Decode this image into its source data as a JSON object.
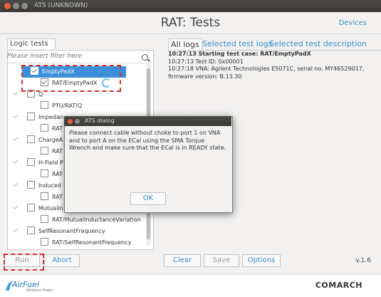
{
  "window": {
    "title": "ATS (UNKNOWN)"
  },
  "header": {
    "title": "RAT: Tests",
    "devices_link": "Devices"
  },
  "left": {
    "tab": "Logic tests",
    "filter_placeholder": "Please insert filter here",
    "tree": [
      {
        "label": "EmptyPadX",
        "level": 0,
        "selected": true,
        "checked": true
      },
      {
        "label": "RAT/EmptyPadX",
        "level": 1,
        "checked": true,
        "running": true
      },
      {
        "label": "Q",
        "level": 0
      },
      {
        "label": "PTU/RAT/Q",
        "level": 1
      },
      {
        "label": "Impedan",
        "level": 0
      },
      {
        "label": "RAT",
        "level": 1
      },
      {
        "label": "ChargeA",
        "level": 0
      },
      {
        "label": "RAT",
        "level": 1
      },
      {
        "label": "H-Field P",
        "level": 0
      },
      {
        "label": "RAT",
        "level": 1
      },
      {
        "label": "Induced",
        "level": 0
      },
      {
        "label": "RAT",
        "level": 1
      },
      {
        "label": "Mutualin",
        "level": 0
      },
      {
        "label": "RAT/MutualInductanceVariation",
        "level": 1
      },
      {
        "label": "SelfResonantFrequency",
        "level": 0
      },
      {
        "label": "RAT/SelfResonantFrequency",
        "level": 1
      }
    ],
    "run_label": "Run",
    "abort_label": "Abort"
  },
  "right": {
    "tabs": [
      "All logs",
      "Selected test logs",
      "Selected test description"
    ],
    "active_tab": 0,
    "logs": [
      "10:27:13 Starting test case: RAT/EmptyPadX",
      "10:27:13 Test ID: 0x00001",
      "10:27:18 VNA: Agilent Technologies E5071C, serial no. MY46529017, firmware version: B.13.30"
    ],
    "clear_label": "Clear",
    "save_label": "Save",
    "options_label": "Options",
    "version": "v.1.6"
  },
  "dialog": {
    "title": "ATS dialog",
    "message": "Please connect cable without choke to port 1 on VNA and to port A on the ECal using the SMA Torque Wrench and make sure that the ECal is in READY state.",
    "ok_label": "OK"
  },
  "footer": {
    "brand_left": "AirFuel",
    "brand_left_sub": "Wireless Power",
    "brand_right": "COMARCH"
  },
  "colors": {
    "accent": "#3a8ec8",
    "selection": "#3d8ed9",
    "highlight_dash": "#d0312d"
  }
}
